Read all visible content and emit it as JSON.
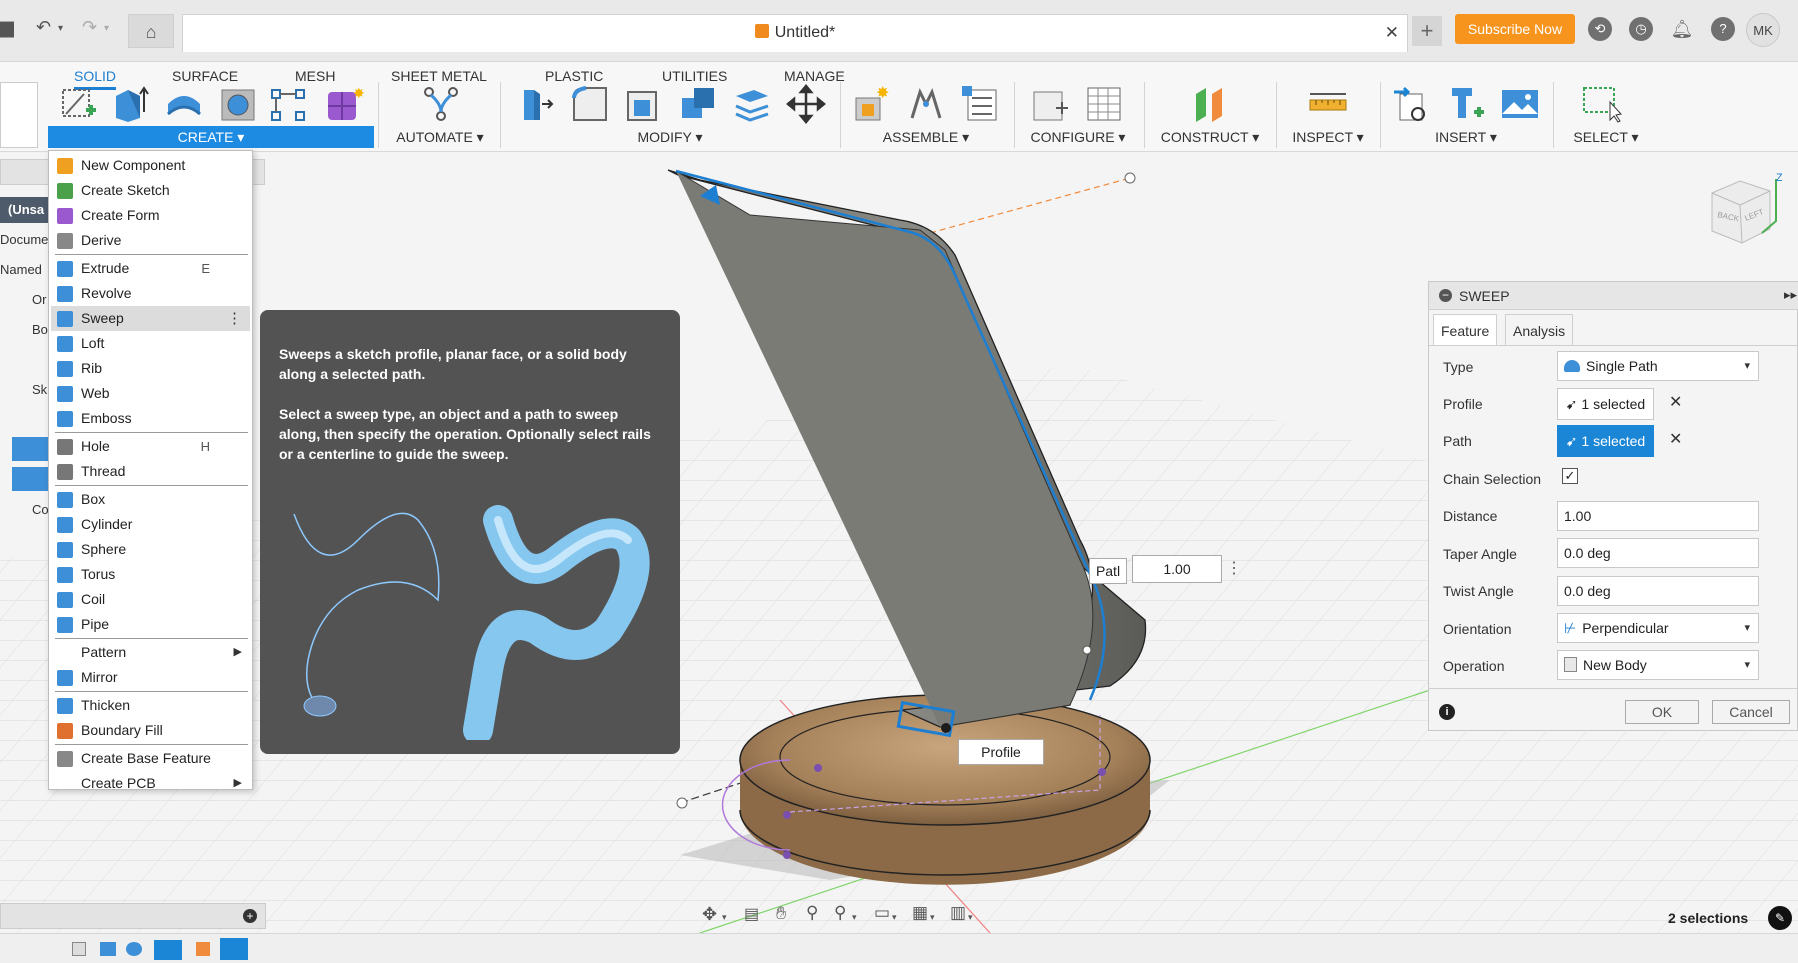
{
  "app": {
    "doc_title": "Untitled*",
    "subscribe": "Subscribe Now",
    "avatar_initials": "MK",
    "accent": "#1e8be3",
    "subscribe_color": "#f7941d"
  },
  "ribbon": {
    "tabs": [
      {
        "label": "SOLID",
        "active": true
      },
      {
        "label": "SURFACE"
      },
      {
        "label": "MESH"
      },
      {
        "label": "SHEET METAL"
      },
      {
        "label": "PLASTIC"
      },
      {
        "label": "UTILITIES"
      },
      {
        "label": "MANAGE"
      }
    ],
    "groups": {
      "create": "CREATE ▾",
      "automate": "AUTOMATE ▾",
      "modify": "MODIFY ▾",
      "assemble": "ASSEMBLE ▾",
      "configure": "CONFIGURE ▾",
      "construct": "CONSTRUCT ▾",
      "inspect": "INSPECT ▾",
      "insert": "INSERT ▾",
      "select": "SELECT ▾"
    }
  },
  "browser": {
    "rows": [
      "(Unsa",
      "Docume",
      "Named",
      "Or",
      "Bo",
      "Sk",
      "Co"
    ]
  },
  "create_menu": {
    "items": [
      {
        "label": "New Component",
        "icon": "new-component-icon",
        "color": "#f0a020"
      },
      {
        "label": "Create Sketch",
        "icon": "create-sketch-icon",
        "color": "#4aa14a"
      },
      {
        "label": "Create Form",
        "icon": "create-form-icon",
        "color": "#9b59d0"
      },
      {
        "label": "Derive",
        "icon": "derive-icon",
        "color": "#888888"
      },
      {
        "label": "Extrude",
        "shortcut": "E",
        "icon": "extrude-icon",
        "color": "#3d8fd8"
      },
      {
        "label": "Revolve",
        "icon": "revolve-icon",
        "color": "#3d8fd8"
      },
      {
        "label": "Sweep",
        "icon": "sweep-icon",
        "color": "#3d8fd8"
      },
      {
        "label": "Loft",
        "icon": "loft-icon",
        "color": "#3d8fd8"
      },
      {
        "label": "Rib",
        "icon": "rib-icon",
        "color": "#3d8fd8"
      },
      {
        "label": "Web",
        "icon": "web-icon",
        "color": "#3d8fd8"
      },
      {
        "label": "Emboss",
        "icon": "emboss-icon",
        "color": "#3d8fd8"
      },
      {
        "label": "Hole",
        "shortcut": "H",
        "icon": "hole-icon",
        "color": "#777777"
      },
      {
        "label": "Thread",
        "icon": "thread-icon",
        "color": "#777777"
      },
      {
        "label": "Box",
        "icon": "box-icon",
        "color": "#3d8fd8"
      },
      {
        "label": "Cylinder",
        "icon": "cylinder-icon",
        "color": "#3d8fd8"
      },
      {
        "label": "Sphere",
        "icon": "sphere-icon",
        "color": "#3d8fd8"
      },
      {
        "label": "Torus",
        "icon": "torus-icon",
        "color": "#3d8fd8"
      },
      {
        "label": "Coil",
        "icon": "coil-icon",
        "color": "#3d8fd8"
      },
      {
        "label": "Pipe",
        "icon": "pipe-icon",
        "color": "#3d8fd8"
      },
      {
        "label": "Pattern",
        "icon": "",
        "color": ""
      },
      {
        "label": "Mirror",
        "icon": "mirror-icon",
        "color": "#3d8fd8"
      },
      {
        "label": "Thicken",
        "icon": "thicken-icon",
        "color": "#3d8fd8"
      },
      {
        "label": "Boundary Fill",
        "icon": "boundary-fill-icon",
        "color": "#e07030"
      },
      {
        "label": "Create Base Feature",
        "icon": "base-feature-icon",
        "color": "#888888"
      },
      {
        "label": "Create PCB",
        "icon": "",
        "color": ""
      }
    ]
  },
  "tooltip": {
    "para1": "Sweeps a sketch profile, planar face, or a solid body along a selected path.",
    "para2": "Select a sweep type, an object and a path to sweep along, then specify the operation. Optionally select rails or a centerline to guide the sweep."
  },
  "viewport": {
    "path_label": "Patl",
    "path_value": "1.00",
    "profile_label": "Profile",
    "viewcube_back": "BACK",
    "viewcube_left": "LEFT",
    "selections": "2 selections"
  },
  "sweep": {
    "title": "SWEEP",
    "tabs": [
      "Feature",
      "Analysis"
    ],
    "type_label": "Type",
    "type_value": "Single Path",
    "profile_label": "Profile",
    "profile_value": "1 selected",
    "path_label": "Path",
    "path_value": "1 selected",
    "chain_label": "Chain Selection",
    "chain_checked": "✓",
    "distance_label": "Distance",
    "distance_value": "1.00",
    "taper_label": "Taper Angle",
    "taper_value": "0.0 deg",
    "twist_label": "Twist Angle",
    "twist_value": "0.0 deg",
    "orientation_label": "Orientation",
    "orientation_value": "Perpendicular",
    "operation_label": "Operation",
    "operation_value": "New Body",
    "ok": "OK",
    "cancel": "Cancel"
  }
}
